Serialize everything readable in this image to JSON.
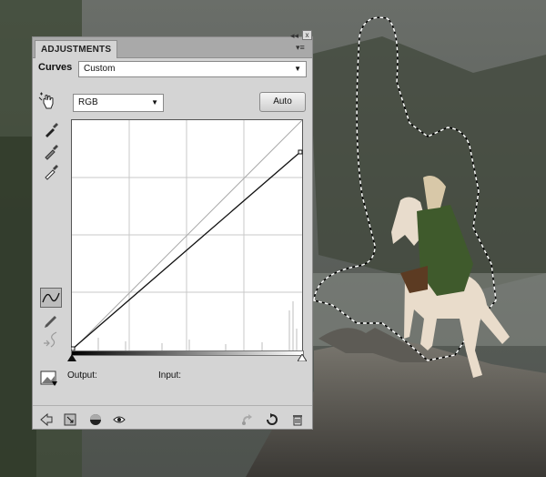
{
  "panel": {
    "tab_label": "ADJUSTMENTS",
    "collapse_glyph": "◂◂",
    "close_glyph": "x",
    "menu_glyph": "▾≡",
    "adjustment_name": "Curves",
    "preset_value": "Custom",
    "channel_value": "RGB",
    "auto_label": "Auto",
    "output_label": "Output:",
    "input_label": "Input:"
  },
  "icons": {
    "on_image_adjust": "hand-target-icon",
    "black_point": "eyedropper-black-icon",
    "gray_point": "eyedropper-gray-icon",
    "white_point": "eyedropper-white-icon",
    "curve_tool": "curve-point-icon",
    "pencil_tool": "pencil-icon",
    "smooth_tool": "smooth-icon",
    "clipping": "clipping-warning-icon",
    "back": "back-arrow-icon",
    "expand": "expand-view-icon",
    "clip_layer": "clip-layer-icon",
    "visibility": "eye-icon",
    "prev_state": "previous-state-icon",
    "reset": "reset-icon",
    "trash": "trash-icon"
  },
  "colors": {
    "panel_bg": "#d4d4d4",
    "tab_bar": "#a9a9a9"
  }
}
